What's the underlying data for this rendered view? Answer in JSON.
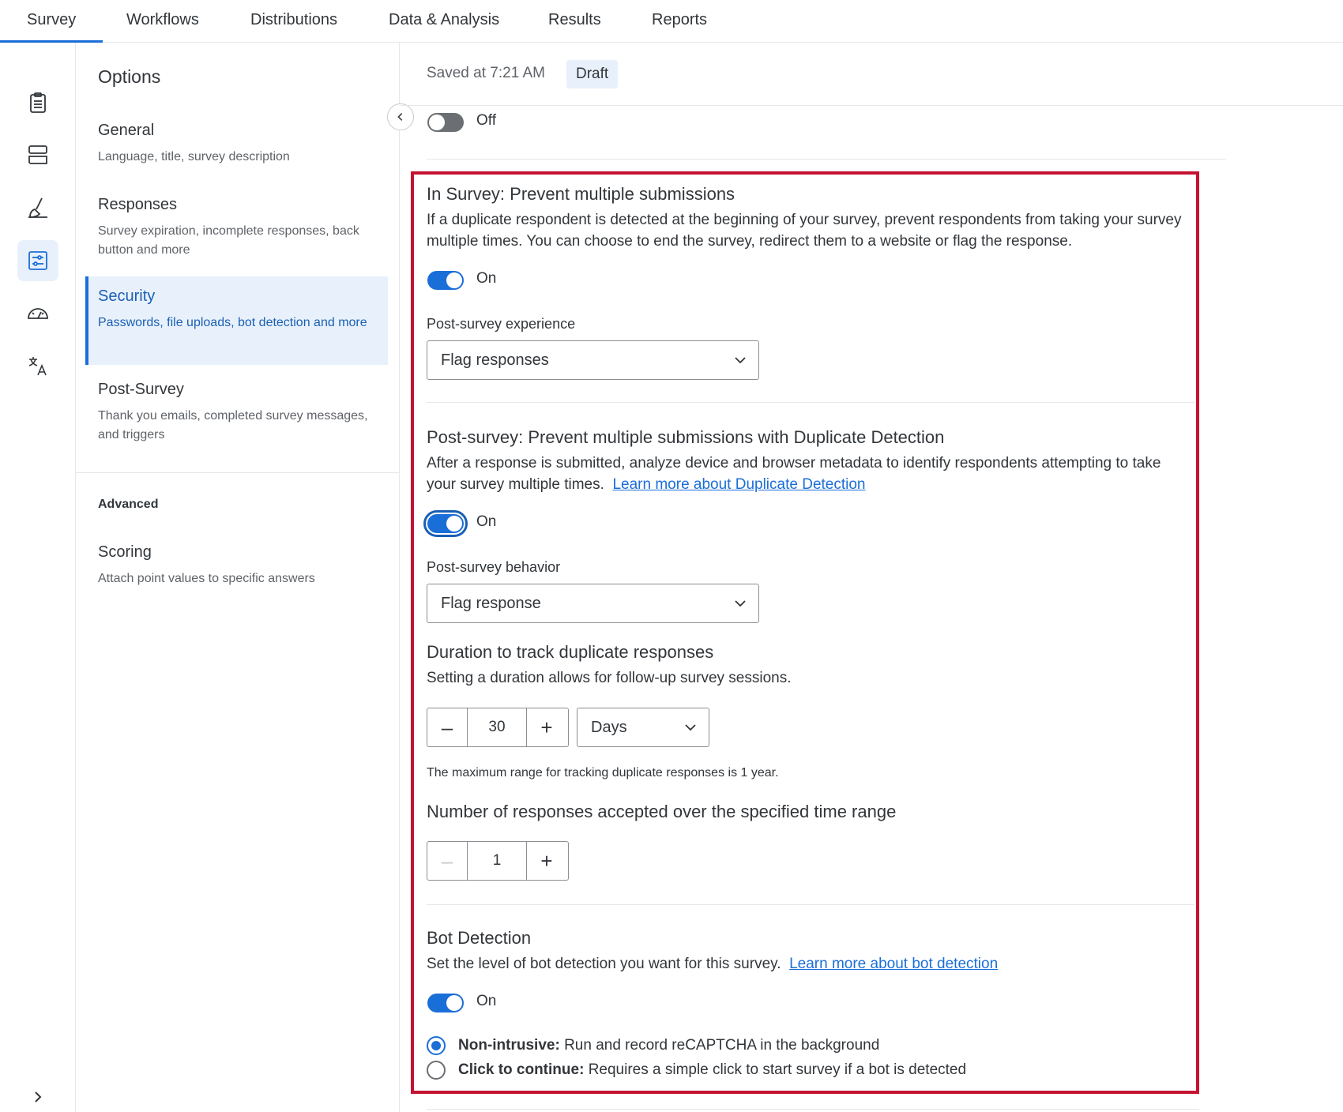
{
  "topnav": {
    "tabs": [
      {
        "label": "Survey"
      },
      {
        "label": "Workflows"
      },
      {
        "label": "Distributions"
      },
      {
        "label": "Data & Analysis"
      },
      {
        "label": "Results"
      },
      {
        "label": "Reports"
      }
    ],
    "active_tab": "Survey",
    "accent_color": "#1a6ed8"
  },
  "rail": {
    "icons": [
      "clipboard-icon",
      "layout-icon",
      "brush-icon",
      "survey-options-icon",
      "gauge-icon",
      "translate-icon"
    ],
    "active_icon": "survey-options-icon",
    "expand_icon": "chevron-right-icon"
  },
  "options": {
    "title": "Options",
    "items": [
      {
        "title": "General",
        "desc": "Language, title, survey description"
      },
      {
        "title": "Responses",
        "desc": "Survey expiration, incomplete responses, back button and more"
      },
      {
        "title": "Security",
        "desc": "Passwords, file uploads, bot detection and more"
      },
      {
        "title": "Post-Survey",
        "desc": "Thank you emails, completed survey messages, and triggers"
      }
    ],
    "active_item": "Security",
    "advanced_label": "Advanced",
    "advanced_items": [
      {
        "title": "Scoring",
        "desc": "Attach point values to specific answers"
      }
    ]
  },
  "main": {
    "saved_text": "Saved at 7:21 AM",
    "draft_badge": "Draft",
    "top_toggle": {
      "state": "Off"
    },
    "in_survey": {
      "title": "In Survey: Prevent multiple submissions",
      "desc": "If a duplicate respondent is detected at the beginning of your survey, prevent respondents from taking your survey multiple times. You can choose to end the survey, redirect them to a website or flag the response.",
      "toggle_label": "On",
      "experience_label": "Post-survey experience",
      "experience_value": "Flag responses"
    },
    "post_survey": {
      "title": "Post-survey: Prevent multiple submissions with Duplicate Detection",
      "desc": "After a response is submitted, analyze device and browser metadata to identify respondents attempting to take your survey multiple times.",
      "link": "Learn more about Duplicate Detection",
      "toggle_label": "On",
      "behavior_label": "Post-survey behavior",
      "behavior_value": "Flag response",
      "duration_title": "Duration to track duplicate responses",
      "duration_desc": "Setting a duration allows for follow-up survey sessions.",
      "duration_value": "30",
      "duration_unit": "Days",
      "duration_note": "The maximum range for tracking duplicate responses is 1 year.",
      "count_title": "Number of responses accepted over the specified time range",
      "count_value": "1"
    },
    "bot": {
      "title": "Bot Detection",
      "desc": "Set the level of bot detection you want for this survey.",
      "link": "Learn more about bot detection",
      "toggle_label": "On",
      "options": [
        {
          "bold": "Non-intrusive:",
          "text": "Run and record reCAPTCHA in the background",
          "selected": true
        },
        {
          "bold": "Click to continue:",
          "text": "Requires a simple click to start survey if a bot is detected",
          "selected": false
        }
      ]
    },
    "highlight_color": "#c41230"
  }
}
